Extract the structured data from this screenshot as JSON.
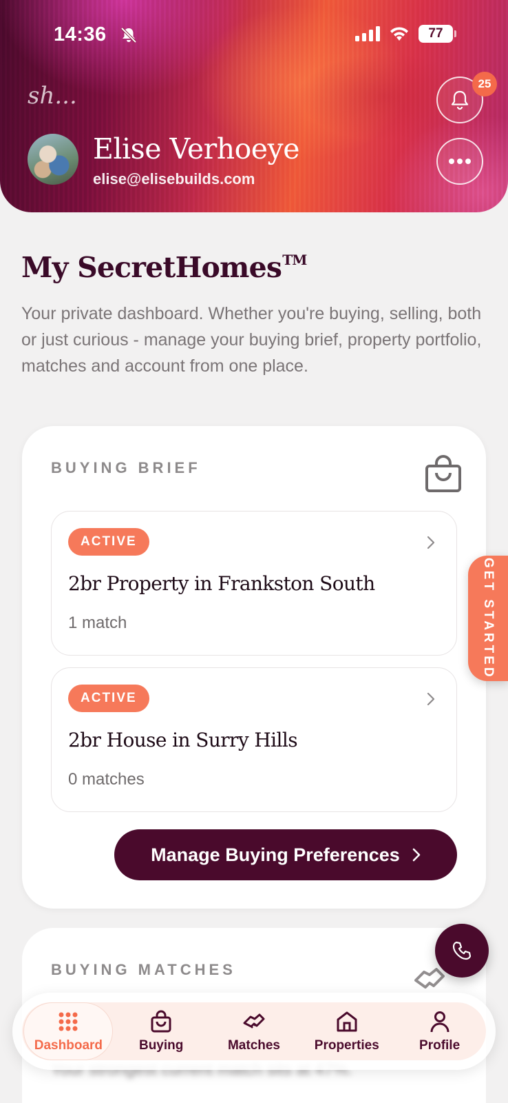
{
  "status_bar": {
    "time": "14:36",
    "battery": "77"
  },
  "header": {
    "logo_text": "sh...",
    "notification_count": "25",
    "user_name": "Elise Verhoeye",
    "user_email": "elise@elisebuilds.com"
  },
  "intro": {
    "title": "My SecretHomes",
    "title_mark": "TM",
    "description": "Your private dashboard. Whether you're buying, selling, both or just curious - manage your buying brief, property portfolio, matches and account from one place."
  },
  "buying_brief": {
    "label": "BUYING BRIEF",
    "items": [
      {
        "status": "ACTIVE",
        "title": "2br Property in Frankston South",
        "matches": "1 match"
      },
      {
        "status": "ACTIVE",
        "title": "2br House in Surry Hills",
        "matches": "0 matches"
      }
    ],
    "manage_button": "Manage Buying Preferences"
  },
  "side_tab": {
    "label": "GET STARTED"
  },
  "buying_matches": {
    "label": "BUYING MATCHES",
    "summary": "Your strongest current match sits at 47%."
  },
  "nav": {
    "items": [
      {
        "label": "Dashboard",
        "icon": "grid-dots-icon",
        "active": true
      },
      {
        "label": "Buying",
        "icon": "bag-icon",
        "active": false
      },
      {
        "label": "Matches",
        "icon": "handshake-icon",
        "active": false
      },
      {
        "label": "Properties",
        "icon": "home-icon",
        "active": false
      },
      {
        "label": "Profile",
        "icon": "person-icon",
        "active": false
      }
    ]
  },
  "colors": {
    "brand_dark": "#4a0a2c",
    "accent_coral": "#f6795a",
    "background": "#f2f1f1"
  }
}
